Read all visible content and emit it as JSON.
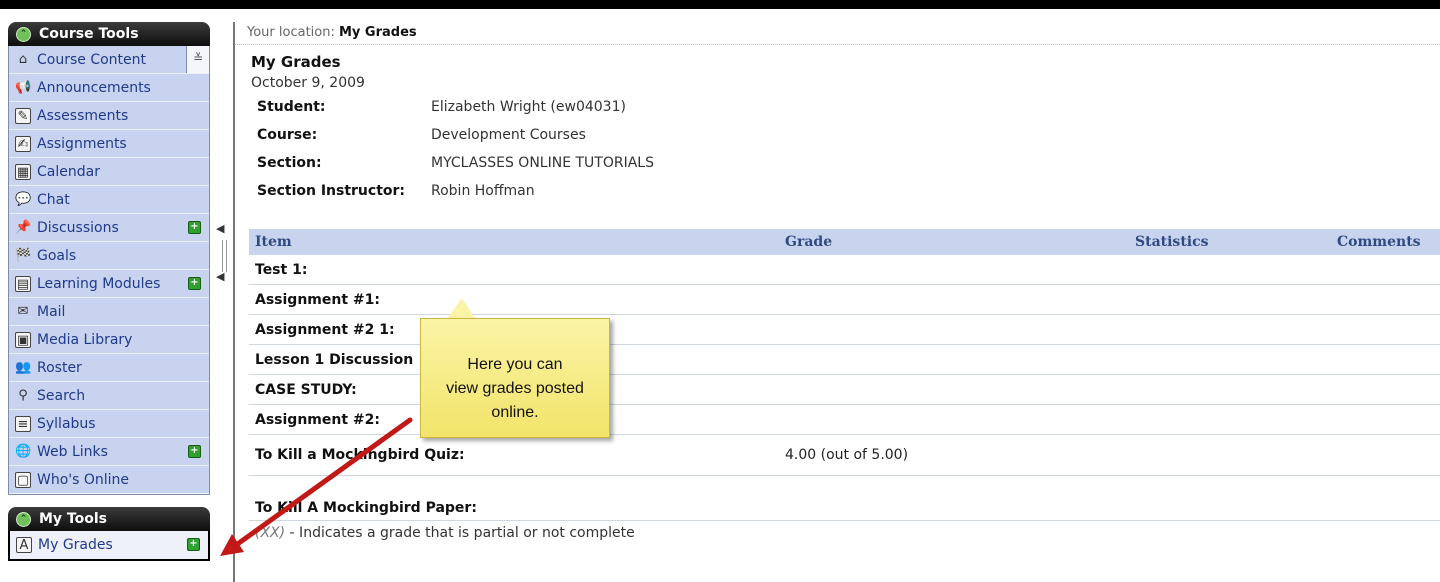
{
  "colors": {
    "sidebar_item_bg": "#c8d3ef",
    "header_dark": "#1a1a1a",
    "table_header_bg": "#c8d4ee",
    "callout_bg": "#f6ea7a",
    "arrow": "#c21818",
    "plus_badge": "#2fa12f"
  },
  "sidebar": {
    "course_tools": {
      "title": "Course Tools",
      "items": [
        {
          "label": "Course Content",
          "icon": "home-icon",
          "has_dropdown": true
        },
        {
          "label": "Announcements",
          "icon": "megaphone-icon"
        },
        {
          "label": "Assessments",
          "icon": "assessment-icon"
        },
        {
          "label": "Assignments",
          "icon": "assignment-icon"
        },
        {
          "label": "Calendar",
          "icon": "calendar-icon"
        },
        {
          "label": "Chat",
          "icon": "chat-icon"
        },
        {
          "label": "Discussions",
          "icon": "discussions-icon",
          "has_plus": true
        },
        {
          "label": "Goals",
          "icon": "goals-icon"
        },
        {
          "label": "Learning Modules",
          "icon": "learning-modules-icon",
          "has_plus": true
        },
        {
          "label": "Mail",
          "icon": "mail-icon"
        },
        {
          "label": "Media Library",
          "icon": "media-library-icon"
        },
        {
          "label": "Roster",
          "icon": "roster-icon"
        },
        {
          "label": "Search",
          "icon": "search-icon"
        },
        {
          "label": "Syllabus",
          "icon": "syllabus-icon"
        },
        {
          "label": "Web Links",
          "icon": "web-links-icon",
          "has_plus": true
        },
        {
          "label": "Who's Online",
          "icon": "whos-online-icon"
        }
      ]
    },
    "my_tools": {
      "title": "My Tools",
      "items": [
        {
          "label": "My Grades",
          "icon": "grades-icon",
          "has_plus": true
        }
      ]
    }
  },
  "main": {
    "breadcrumb_prefix": "Your location:",
    "breadcrumb_current": "My Grades",
    "title": "My Grades",
    "date": "October 9, 2009",
    "info": {
      "student_label": "Student:",
      "student_value": "Elizabeth Wright (ew04031)",
      "course_label": "Course:",
      "course_value": "Development Courses",
      "section_label": "Section:",
      "section_value": "MYCLASSES ONLINE TUTORIALS",
      "instructor_label": "Section Instructor:",
      "instructor_value": "Robin Hoffman"
    },
    "table": {
      "headers": [
        "Item",
        "Grade",
        "Statistics",
        "Comments"
      ],
      "rows": [
        {
          "item": "Test 1:",
          "grade": ""
        },
        {
          "item": "Assignment #1:",
          "grade": ""
        },
        {
          "item": "Assignment #2 1:",
          "grade": ""
        },
        {
          "item": "Lesson 1 Discussion",
          "grade": ""
        },
        {
          "item": "CASE STUDY:",
          "grade": ""
        },
        {
          "item": "Assignment #2:",
          "grade": ""
        },
        {
          "item": "To Kill a Mockingbird Quiz:",
          "grade": "4.00  (out of 5.00)"
        },
        {
          "item": "To Kill A Mockingbird Paper:",
          "grade": ""
        }
      ]
    },
    "footnote_marker": "(XX)",
    "footnote_text": " - Indicates a grade that is partial or not complete"
  },
  "callout": {
    "line1": "Here you can",
    "line2": "view grades posted",
    "line3": "online."
  }
}
